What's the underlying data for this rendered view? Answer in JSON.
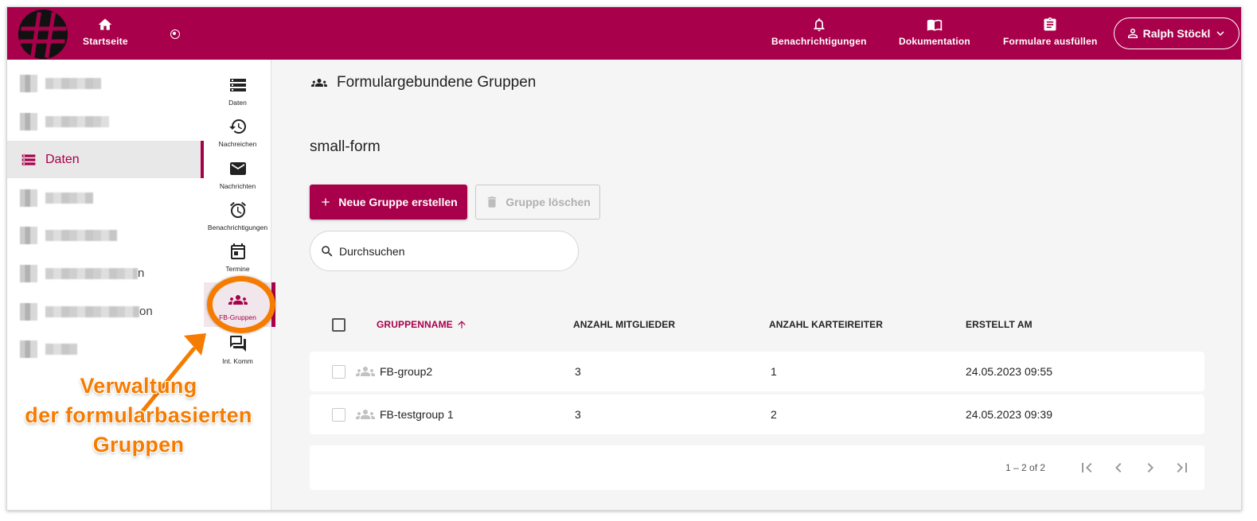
{
  "topbar": {
    "home_label": "Startseite",
    "notifications_label": "Benachrichtigungen",
    "docs_label": "Dokumentation",
    "forms_label": "Formulare ausfüllen",
    "user_label": "Ralph Stöckl",
    "brand_color": "#a8004a"
  },
  "leftnav": {
    "active_label": "Daten",
    "partial_labels": [
      "n",
      "on"
    ]
  },
  "rail": {
    "items": [
      {
        "label": "Daten",
        "icon": "storage-icon"
      },
      {
        "label": "Nachreichen",
        "icon": "history-icon"
      },
      {
        "label": "Nachrichten",
        "icon": "mail-icon"
      },
      {
        "label": "Benachrichtigungen",
        "icon": "alarm-icon"
      },
      {
        "label": "Termine",
        "icon": "calendar-icon"
      },
      {
        "label": "FB-Gruppen",
        "icon": "groups-icon"
      },
      {
        "label": "Int. Komm",
        "icon": "forum-icon"
      }
    ]
  },
  "annotation": {
    "line1": "Verwaltung",
    "line2": "der formularbasierten",
    "line3": "Gruppen",
    "color": "#f57c00"
  },
  "main": {
    "title": "Formulargebundene Gruppen",
    "form_name": "small-form",
    "new_button": "Neue Gruppe erstellen",
    "delete_button": "Gruppe löschen",
    "search_placeholder": "Durchsuchen",
    "columns": [
      "GRUPPENNAME",
      "ANZAHL MITGLIEDER",
      "ANZAHL KARTEIREITER",
      "ERSTELLT AM"
    ],
    "rows": [
      {
        "name": "FB-group2",
        "members": "3",
        "tabs": "1",
        "created": "24.05.2023 09:55"
      },
      {
        "name": "FB-testgroup 1",
        "members": "3",
        "tabs": "2",
        "created": "24.05.2023 09:39"
      }
    ],
    "pagination": "1 – 2 of 2"
  }
}
